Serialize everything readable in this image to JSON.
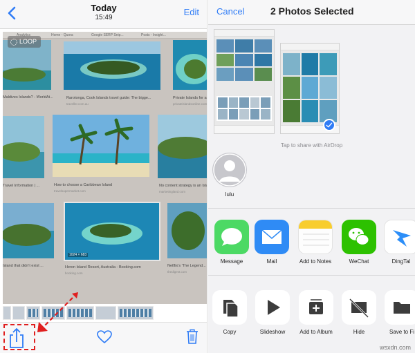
{
  "left": {
    "nav": {
      "title": "Today",
      "time": "15:49",
      "edit_label": "Edit"
    },
    "photo": {
      "loop_label": "LOOP",
      "tabs": [
        "Analytics",
        "Home - Quora",
        "Google SERP Snip...",
        "Posts - Insight..."
      ],
      "captions": {
        "c1": "Maldives Islands? - WorldAt...",
        "c2": "Rarotonga, Cook Islands travel guide: The bigge...",
        "c2_sub": "traveller.com.au",
        "c3": "Private Islands for sale...",
        "c3_sub": "privateislandsonline.com",
        "c4": "Travel Information | ...",
        "c5": "How to choose a Caribbean Island",
        "c5_sub": "travelsupermarket.com",
        "c6": "No content strategy is an Island",
        "c6_sub": "marketingland.com",
        "c7": "Island that didn't exist ...",
        "c8": "Heron Island Resort, Australia - Booking.com",
        "c8_sub": "booking.com",
        "c9": "Netflix's 'The Legend...",
        "c9_sub": "thedigest.com",
        "size": "1024 × 683"
      }
    },
    "toolbar": {
      "share_icon": "share-icon",
      "heart_icon": "heart-icon",
      "trash_icon": "trash-icon"
    },
    "colors": {
      "accent": "#2f7cf6",
      "highlight": "#e01f1f"
    }
  },
  "right": {
    "nav": {
      "cancel_label": "Cancel",
      "title": "2 Photos Selected"
    },
    "airdrop_hint": "Tap to share with AirDrop",
    "contact": {
      "name": "lulu"
    },
    "apps": [
      {
        "label": "Message",
        "icon": "message-icon"
      },
      {
        "label": "Mail",
        "icon": "mail-icon"
      },
      {
        "label": "Add to Notes",
        "icon": "notes-icon"
      },
      {
        "label": "WeChat",
        "icon": "wechat-icon"
      },
      {
        "label": "DingTal",
        "icon": "dingtalk-icon"
      }
    ],
    "actions": [
      {
        "label": "Copy",
        "icon": "copy-icon"
      },
      {
        "label": "Slideshow",
        "icon": "play-icon"
      },
      {
        "label": "Add to Album",
        "icon": "add-album-icon"
      },
      {
        "label": "Hide",
        "icon": "hide-icon"
      },
      {
        "label": "Save to Fi",
        "icon": "folder-icon"
      }
    ]
  },
  "watermark": "wsxdn.com"
}
